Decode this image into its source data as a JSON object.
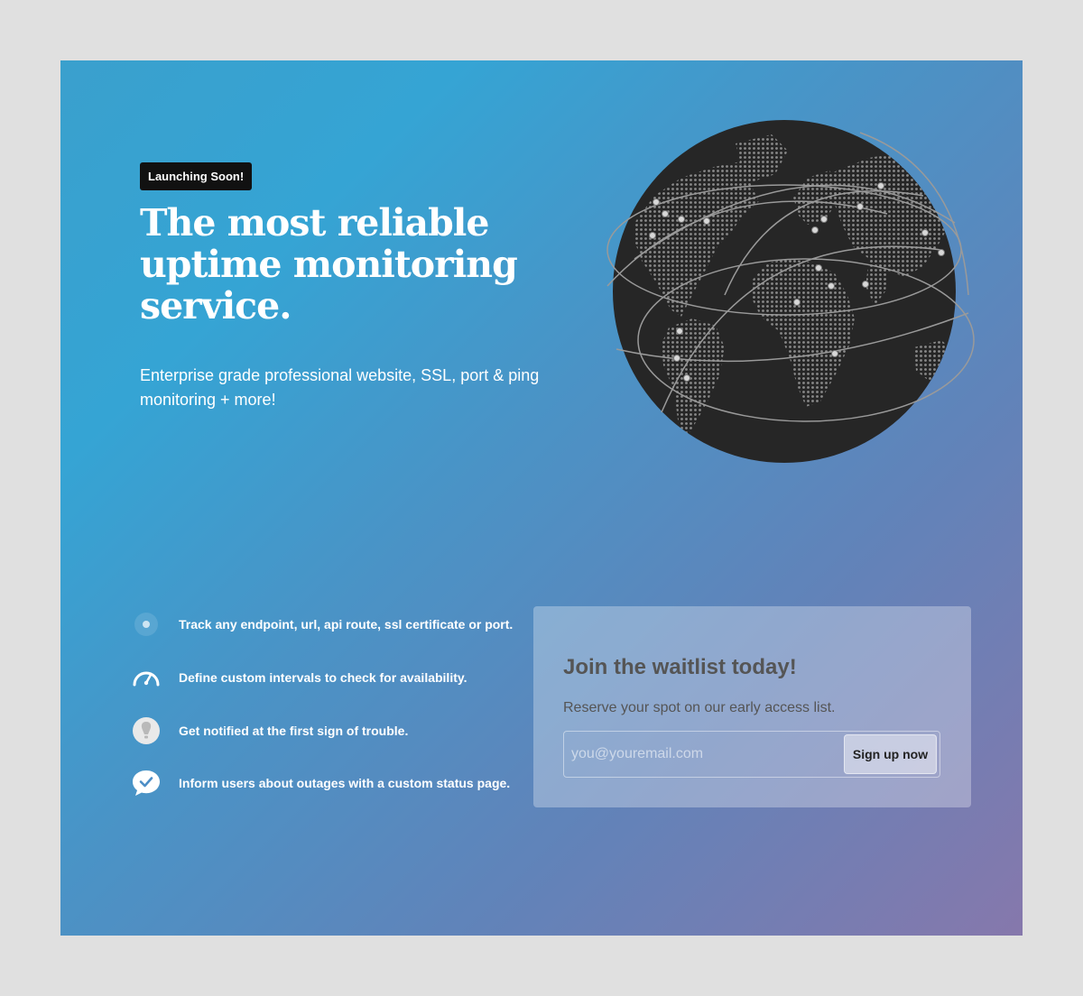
{
  "hero": {
    "badge": "Launching Soon!",
    "title": "The most reliable uptime monitoring service.",
    "subtitle": "Enterprise grade professional website, SSL, port & ping monitoring + more!"
  },
  "features": [
    {
      "icon": "pulse-dot-icon",
      "text": "Track any endpoint, url, api route, ssl certificate or port."
    },
    {
      "icon": "speedometer-icon",
      "text": "Define custom intervals to check for availability."
    },
    {
      "icon": "alert-bulb-icon",
      "text": "Get notified at the first sign of trouble."
    },
    {
      "icon": "chat-check-icon",
      "text": "Inform users about outages with a custom status page."
    }
  ],
  "waitlist": {
    "title": "Join the waitlist today!",
    "description": "Reserve your spot on our early access list.",
    "email_placeholder": "you@youremail.com",
    "email_value": "",
    "button_label": "Sign up now"
  },
  "colors": {
    "gradient_start": "#35a4d4",
    "gradient_end": "#8678ac",
    "globe": "#262626",
    "badge_bg": "#111111"
  }
}
